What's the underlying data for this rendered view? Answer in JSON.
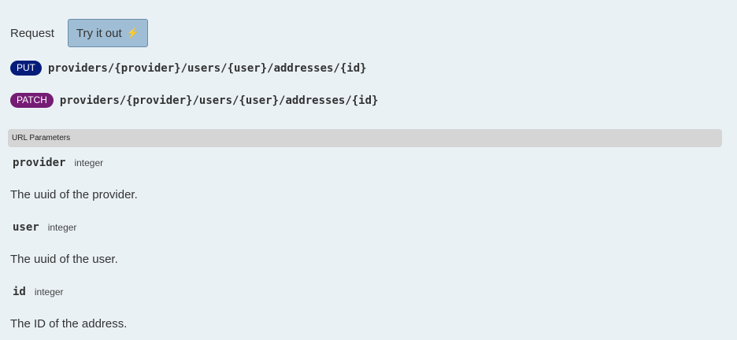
{
  "request": {
    "label": "Request",
    "try_button_label": "Try it out",
    "try_button_icon": "⚡"
  },
  "endpoints": [
    {
      "method": "PUT",
      "path": "providers/{provider}/users/{user}/addresses/{id}",
      "color": "#061c7a"
    },
    {
      "method": "PATCH",
      "path": "providers/{provider}/users/{user}/addresses/{id}",
      "color": "#751c74"
    }
  ],
  "url_parameters": {
    "header": "URL Parameters",
    "params": [
      {
        "name": "provider",
        "type": "integer",
        "description": "The uuid of the provider."
      },
      {
        "name": "user",
        "type": "integer",
        "description": "The uuid of the user."
      },
      {
        "name": "id",
        "type": "integer",
        "description": "The ID of the address."
      }
    ]
  }
}
